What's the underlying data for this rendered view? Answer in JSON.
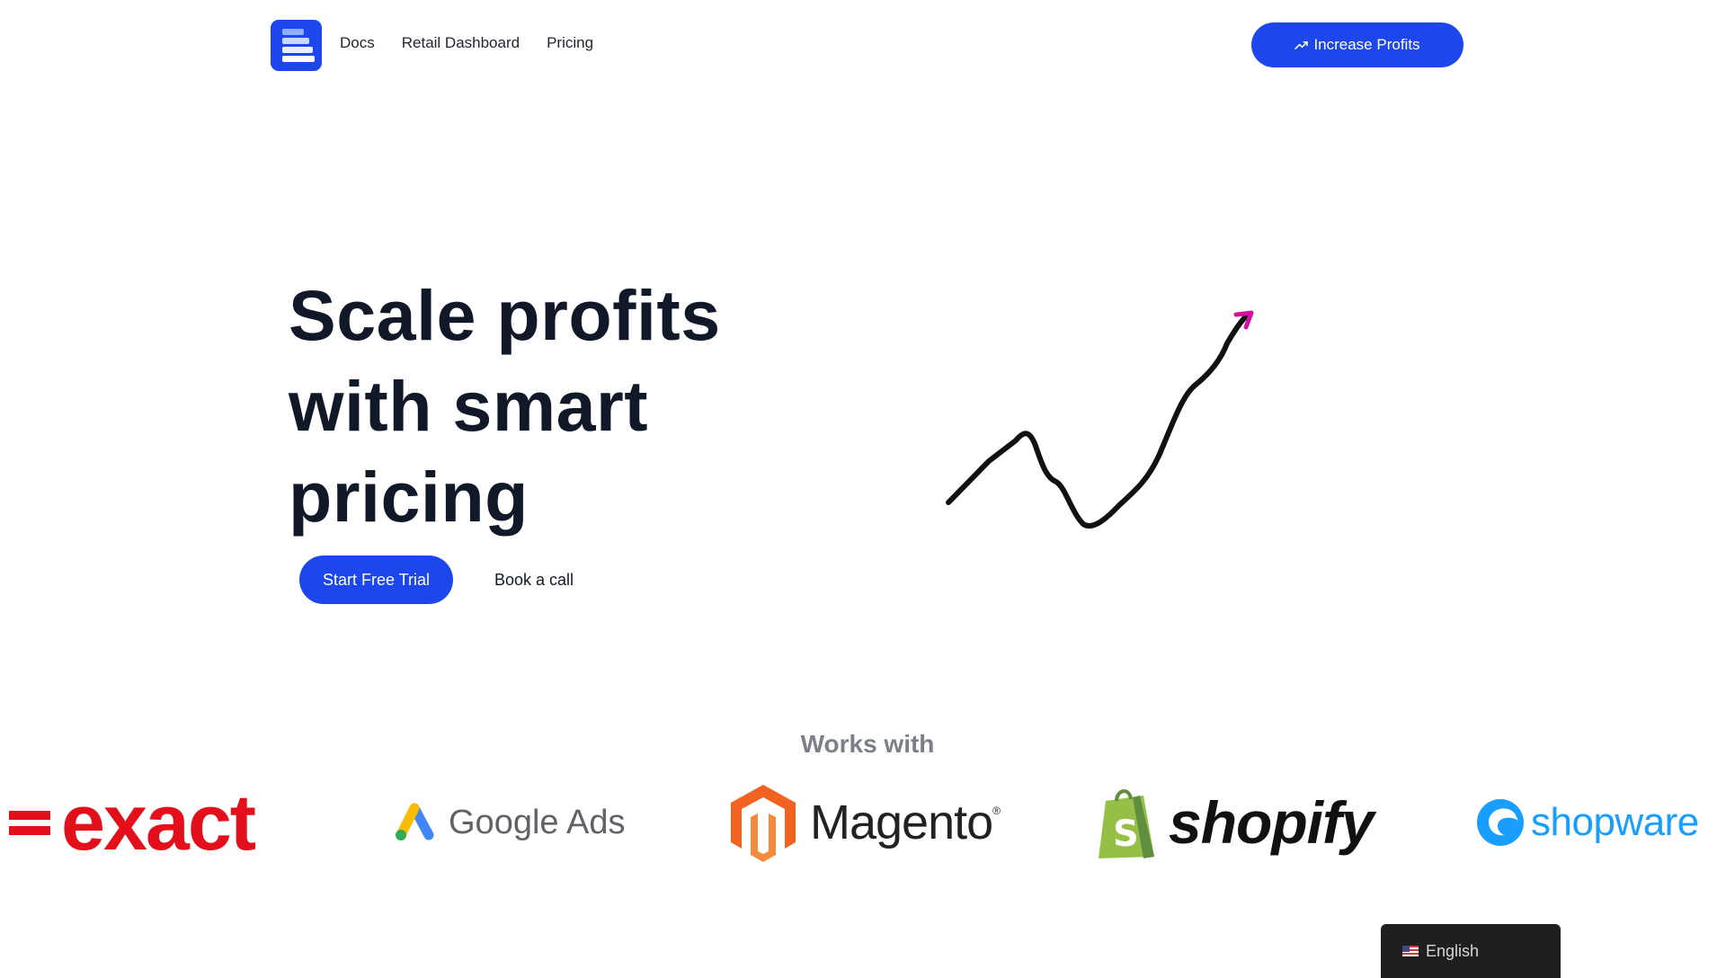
{
  "brand": {
    "accent": "#1d47ec",
    "logo_icon": "stacked-bars-icon"
  },
  "nav": {
    "items": [
      {
        "label": "Docs"
      },
      {
        "label": "Retail Dashboard"
      },
      {
        "label": "Pricing"
      }
    ]
  },
  "header_cta": {
    "label": "Increase Profits",
    "icon": "trending-up-icon"
  },
  "hero": {
    "title": "Scale profits with smart pricing",
    "primary_button": "Start Free Trial",
    "secondary_button": "Book a call",
    "illustration": "growth-bar-chart-illustration"
  },
  "works_with": {
    "title": "Works with",
    "logos": [
      {
        "name": "exact",
        "text": "exact",
        "color": "#e3101b"
      },
      {
        "name": "google-ads",
        "text": "Google Ads"
      },
      {
        "name": "magento",
        "text": "Magento",
        "mark": "®"
      },
      {
        "name": "shopify",
        "text": "shopify",
        "color": "#95bf47"
      },
      {
        "name": "shopware",
        "text": "shopware",
        "color": "#189eff"
      }
    ]
  },
  "language": {
    "label": "English",
    "flag": "us-flag-icon"
  }
}
